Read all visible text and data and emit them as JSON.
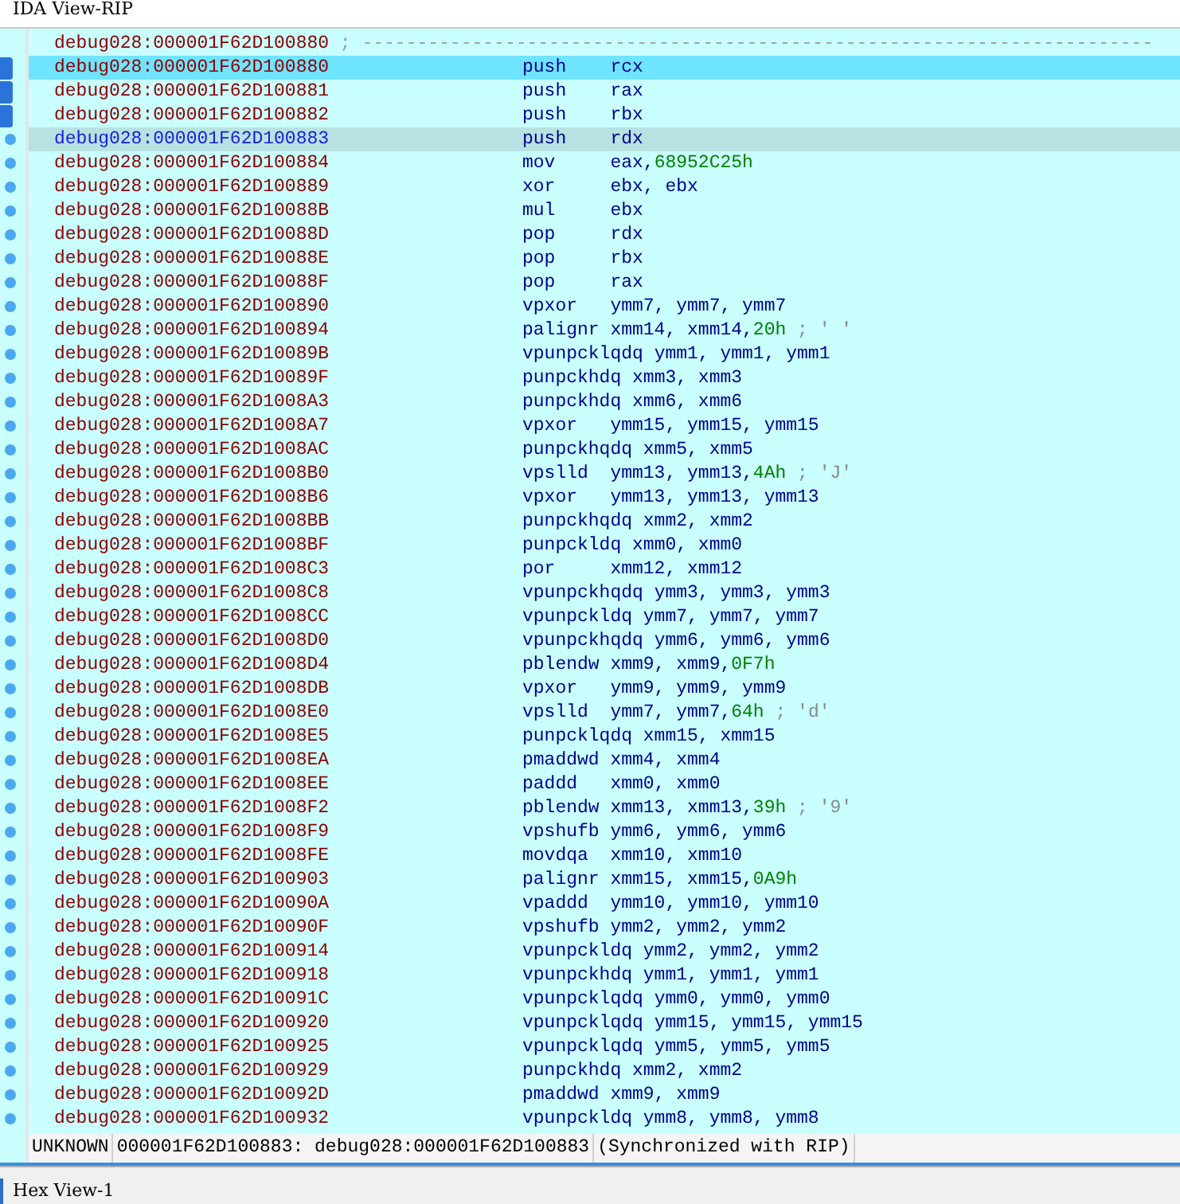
{
  "window": {
    "title": "IDA View-RIP"
  },
  "listing": [
    {
      "address": "debug028:000001F62D100880",
      "separator": "; ------------------------------------------------------------------------",
      "selected": false,
      "is_rip": false,
      "arrow": false
    },
    {
      "address": "debug028:000001F62D100880",
      "mnemonic": "push",
      "operands": "rcx",
      "selected": true,
      "is_rip": false,
      "arrow": true
    },
    {
      "address": "debug028:000001F62D100881",
      "mnemonic": "push",
      "operands": "rax",
      "selected": false,
      "is_rip": false,
      "arrow": true
    },
    {
      "address": "debug028:000001F62D100882",
      "mnemonic": "push",
      "operands": "rbx",
      "selected": false,
      "is_rip": false,
      "arrow": true
    },
    {
      "address": "debug028:000001F62D100883",
      "mnemonic": "push",
      "operands": "rdx",
      "selected": false,
      "is_rip": true,
      "arrow": false
    },
    {
      "address": "debug028:000001F62D100884",
      "mnemonic": "mov",
      "operands": "eax, ",
      "immediate": "68952C25h",
      "selected": false,
      "is_rip": false,
      "arrow": false
    },
    {
      "address": "debug028:000001F62D100889",
      "mnemonic": "xor",
      "operands": "ebx, ebx",
      "selected": false,
      "is_rip": false,
      "arrow": false
    },
    {
      "address": "debug028:000001F62D10088B",
      "mnemonic": "mul",
      "operands": "ebx",
      "selected": false,
      "is_rip": false,
      "arrow": false
    },
    {
      "address": "debug028:000001F62D10088D",
      "mnemonic": "pop",
      "operands": "rdx",
      "selected": false,
      "is_rip": false,
      "arrow": false
    },
    {
      "address": "debug028:000001F62D10088E",
      "mnemonic": "pop",
      "operands": "rbx",
      "selected": false,
      "is_rip": false,
      "arrow": false
    },
    {
      "address": "debug028:000001F62D10088F",
      "mnemonic": "pop",
      "operands": "rax",
      "selected": false,
      "is_rip": false,
      "arrow": false
    },
    {
      "address": "debug028:000001F62D100890",
      "mnemonic": "vpxor",
      "operands": "ymm7, ymm7, ymm7",
      "selected": false,
      "is_rip": false,
      "arrow": false
    },
    {
      "address": "debug028:000001F62D100894",
      "mnemonic": "palignr",
      "operands": "xmm14, xmm14, ",
      "immediate": "20h",
      "comment": "; ' '",
      "selected": false,
      "is_rip": false,
      "arrow": false
    },
    {
      "address": "debug028:000001F62D10089B",
      "mnemonic": "vpunpcklqdq",
      "operands": "ymm1, ymm1, ymm1",
      "selected": false,
      "is_rip": false,
      "arrow": false
    },
    {
      "address": "debug028:000001F62D10089F",
      "mnemonic": "punpckhdq",
      "operands": "xmm3, xmm3",
      "selected": false,
      "is_rip": false,
      "arrow": false
    },
    {
      "address": "debug028:000001F62D1008A3",
      "mnemonic": "punpckhdq",
      "operands": "xmm6, xmm6",
      "selected": false,
      "is_rip": false,
      "arrow": false
    },
    {
      "address": "debug028:000001F62D1008A7",
      "mnemonic": "vpxor",
      "operands": "ymm15, ymm15, ymm15",
      "selected": false,
      "is_rip": false,
      "arrow": false
    },
    {
      "address": "debug028:000001F62D1008AC",
      "mnemonic": "punpckhqdq",
      "operands": "xmm5, xmm5",
      "selected": false,
      "is_rip": false,
      "arrow": false
    },
    {
      "address": "debug028:000001F62D1008B0",
      "mnemonic": "vpslld",
      "operands": "ymm13, ymm13, ",
      "immediate": "4Ah",
      "comment": "; 'J'",
      "selected": false,
      "is_rip": false,
      "arrow": false
    },
    {
      "address": "debug028:000001F62D1008B6",
      "mnemonic": "vpxor",
      "operands": "ymm13, ymm13, ymm13",
      "selected": false,
      "is_rip": false,
      "arrow": false
    },
    {
      "address": "debug028:000001F62D1008BB",
      "mnemonic": "punpckhqdq",
      "operands": "xmm2, xmm2",
      "selected": false,
      "is_rip": false,
      "arrow": false
    },
    {
      "address": "debug028:000001F62D1008BF",
      "mnemonic": "punpckldq",
      "operands": "xmm0, xmm0",
      "selected": false,
      "is_rip": false,
      "arrow": false
    },
    {
      "address": "debug028:000001F62D1008C3",
      "mnemonic": "por",
      "operands": "xmm12, xmm12",
      "selected": false,
      "is_rip": false,
      "arrow": false
    },
    {
      "address": "debug028:000001F62D1008C8",
      "mnemonic": "vpunpckhqdq",
      "operands": "ymm3, ymm3, ymm3",
      "selected": false,
      "is_rip": false,
      "arrow": false
    },
    {
      "address": "debug028:000001F62D1008CC",
      "mnemonic": "vpunpckldq",
      "operands": "ymm7, ymm7, ymm7",
      "selected": false,
      "is_rip": false,
      "arrow": false
    },
    {
      "address": "debug028:000001F62D1008D0",
      "mnemonic": "vpunpckhqdq",
      "operands": "ymm6, ymm6, ymm6",
      "selected": false,
      "is_rip": false,
      "arrow": false
    },
    {
      "address": "debug028:000001F62D1008D4",
      "mnemonic": "pblendw",
      "operands": "xmm9, xmm9, ",
      "immediate": "0F7h",
      "selected": false,
      "is_rip": false,
      "arrow": false
    },
    {
      "address": "debug028:000001F62D1008DB",
      "mnemonic": "vpxor",
      "operands": "ymm9, ymm9, ymm9",
      "selected": false,
      "is_rip": false,
      "arrow": false
    },
    {
      "address": "debug028:000001F62D1008E0",
      "mnemonic": "vpslld",
      "operands": "ymm7, ymm7, ",
      "immediate": "64h",
      "comment": "; 'd'",
      "selected": false,
      "is_rip": false,
      "arrow": false
    },
    {
      "address": "debug028:000001F62D1008E5",
      "mnemonic": "punpcklqdq",
      "operands": "xmm15, xmm15",
      "selected": false,
      "is_rip": false,
      "arrow": false
    },
    {
      "address": "debug028:000001F62D1008EA",
      "mnemonic": "pmaddwd",
      "operands": "xmm4, xmm4",
      "selected": false,
      "is_rip": false,
      "arrow": false
    },
    {
      "address": "debug028:000001F62D1008EE",
      "mnemonic": "paddd",
      "operands": "xmm0, xmm0",
      "selected": false,
      "is_rip": false,
      "arrow": false
    },
    {
      "address": "debug028:000001F62D1008F2",
      "mnemonic": "pblendw",
      "operands": "xmm13, xmm13, ",
      "immediate": "39h",
      "comment": "; '9'",
      "selected": false,
      "is_rip": false,
      "arrow": false
    },
    {
      "address": "debug028:000001F62D1008F9",
      "mnemonic": "vpshufb",
      "operands": "ymm6, ymm6, ymm6",
      "selected": false,
      "is_rip": false,
      "arrow": false
    },
    {
      "address": "debug028:000001F62D1008FE",
      "mnemonic": "movdqa",
      "operands": "xmm10, xmm10",
      "selected": false,
      "is_rip": false,
      "arrow": false
    },
    {
      "address": "debug028:000001F62D100903",
      "mnemonic": "palignr",
      "operands": "xmm15, xmm15, ",
      "immediate": "0A9h",
      "selected": false,
      "is_rip": false,
      "arrow": false
    },
    {
      "address": "debug028:000001F62D10090A",
      "mnemonic": "vpaddd",
      "operands": "ymm10, ymm10, ymm10",
      "selected": false,
      "is_rip": false,
      "arrow": false
    },
    {
      "address": "debug028:000001F62D10090F",
      "mnemonic": "vpshufb",
      "operands": "ymm2, ymm2, ymm2",
      "selected": false,
      "is_rip": false,
      "arrow": false
    },
    {
      "address": "debug028:000001F62D100914",
      "mnemonic": "vpunpckldq",
      "operands": "ymm2, ymm2, ymm2",
      "selected": false,
      "is_rip": false,
      "arrow": false
    },
    {
      "address": "debug028:000001F62D100918",
      "mnemonic": "vpunpckhdq",
      "operands": "ymm1, ymm1, ymm1",
      "selected": false,
      "is_rip": false,
      "arrow": false
    },
    {
      "address": "debug028:000001F62D10091C",
      "mnemonic": "vpunpcklqdq",
      "operands": "ymm0, ymm0, ymm0",
      "selected": false,
      "is_rip": false,
      "arrow": false
    },
    {
      "address": "debug028:000001F62D100920",
      "mnemonic": "vpunpcklqdq",
      "operands": "ymm15, ymm15, ymm15",
      "selected": false,
      "is_rip": false,
      "arrow": false
    },
    {
      "address": "debug028:000001F62D100925",
      "mnemonic": "vpunpcklqdq",
      "operands": "ymm5, ymm5, ymm5",
      "selected": false,
      "is_rip": false,
      "arrow": false
    },
    {
      "address": "debug028:000001F62D100929",
      "mnemonic": "punpckhdq",
      "operands": "xmm2, xmm2",
      "selected": false,
      "is_rip": false,
      "arrow": false
    },
    {
      "address": "debug028:000001F62D10092D",
      "mnemonic": "pmaddwd",
      "operands": "xmm9, xmm9",
      "selected": false,
      "is_rip": false,
      "arrow": false
    },
    {
      "address": "debug028:000001F62D100932",
      "mnemonic": "vpunpckldq",
      "operands": "ymm8, ymm8, ymm8",
      "selected": false,
      "is_rip": false,
      "arrow": false
    }
  ],
  "status_bar": [
    "UNKNOWN",
    "000001F62D100883: debug028:000001F62D100883",
    "(Synchronized with RIP)"
  ],
  "bottom_tab": {
    "title": "Hex View-1"
  }
}
